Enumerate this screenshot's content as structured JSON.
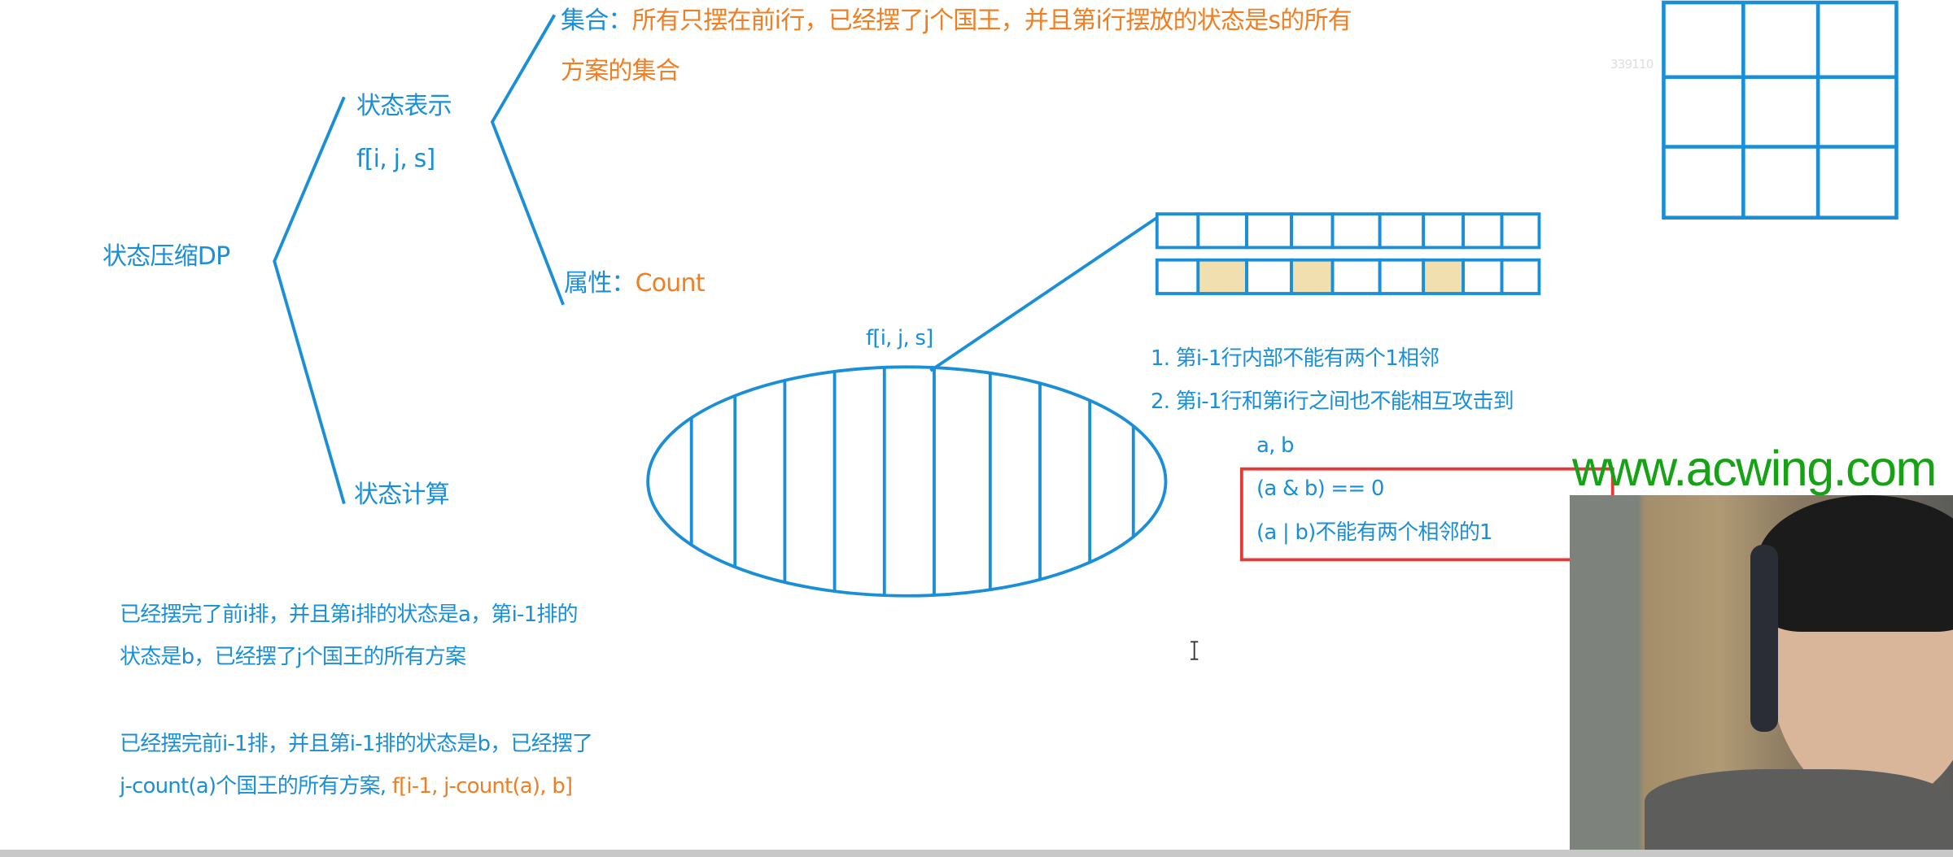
{
  "title": "状态压缩DP",
  "repr": {
    "label": "状态表示",
    "fn": "f[i, j, s]"
  },
  "set": {
    "label": "集合：",
    "text1": "所有只摆在前i行，已经摆了j个国王，并且第i行摆放的状态是s的所有",
    "text2": "方案的集合"
  },
  "attr": {
    "label": "属性：",
    "value": "Count"
  },
  "calc": {
    "label": "状态计算"
  },
  "ellipse_label": "f[i, j, s]",
  "rules": [
    "1. 第i-1行内部不能有两个1相邻",
    "2. 第i-1行和第i行之间也不能相互攻击到"
  ],
  "ab": "a, b",
  "conditions": [
    "(a & b) == 0",
    "(a | b)不能有两个相邻的1"
  ],
  "desc1": [
    "已经摆完了前i排，并且第i排的状态是a，第i-1排的",
    "状态是b，已经摆了j个国王的所有方案"
  ],
  "desc2": {
    "line1": "已经摆完前i-1排，并且第i-1排的状态是b，已经摆了",
    "line2": "j-count(a)个国王的所有方案, ",
    "formula": "f[i-1, j-count(a), b]"
  },
  "row_state": [
    0,
    1,
    0,
    1,
    0,
    0,
    1,
    0,
    0
  ],
  "watermark": "www.acwing.com",
  "faint_id": "339110",
  "colors": {
    "blue": "#1a8fd8",
    "orange": "#f07e22",
    "red": "#e53935",
    "fill": "#f2dfb0",
    "green": "#15a315"
  }
}
